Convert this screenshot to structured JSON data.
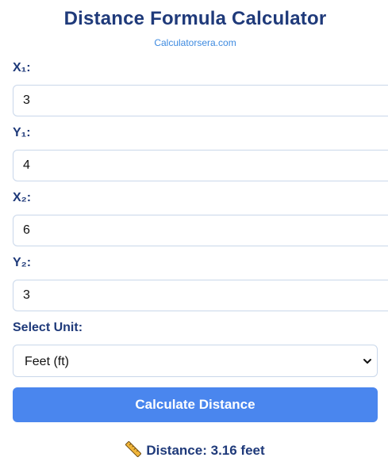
{
  "header": {
    "title": "Distance Formula Calculator",
    "site": "Calculatorsera.com"
  },
  "fields": [
    {
      "label": "X₁:",
      "value": "3"
    },
    {
      "label": "Y₁:",
      "value": "4"
    },
    {
      "label": "X₂:",
      "value": "6"
    },
    {
      "label": "Y₂:",
      "value": "3"
    }
  ],
  "unit": {
    "label": "Select Unit:",
    "selected": "Feet (ft)"
  },
  "button": {
    "label": "Calculate Distance"
  },
  "result": {
    "icon": "ruler-icon",
    "label": "Distance:",
    "value": "3.16 feet"
  },
  "colors": {
    "heading": "#1f3a7a",
    "link": "#3d8ae0",
    "button": "#4a86ee",
    "input_border": "#c9d7ea"
  }
}
